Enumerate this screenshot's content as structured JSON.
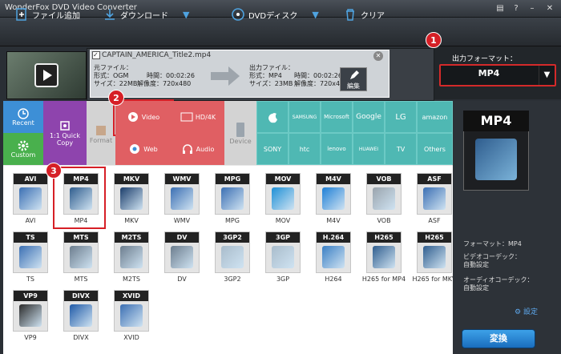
{
  "app": {
    "title": "WonderFox DVD Video Converter"
  },
  "toolbar": {
    "add_file": "ファイル追加",
    "download": "ダウンロード",
    "dvd_disc": "DVDディスク",
    "clear": "クリア"
  },
  "task": {
    "name": "CAPTAIN_AMERICA_Title2.mp4",
    "src_label": "元ファイル：",
    "src_format": "形式：OGM",
    "src_time": "時間：00:02:26",
    "src_size": "サイズ：22MB",
    "src_res": "解像度：720x480",
    "out_label": "出力ファイル：",
    "out_format": "形式：MP4",
    "out_time": "時間：00:02:26",
    "out_size": "サイズ：23MB",
    "out_res": "解像度：720x480",
    "edit": "編集"
  },
  "output": {
    "label": "出力フォーマット：",
    "value": "MP4"
  },
  "badges": {
    "b1": "1",
    "b2": "2",
    "b3": "3"
  },
  "categories": {
    "recent": "Recent",
    "custom": "Custom",
    "quick_copy": "1:1 Quick Copy",
    "format": "Format",
    "video": "Video",
    "hd": "HD/4K",
    "web": "Web",
    "audio": "Audio",
    "device": "Device"
  },
  "brands": {
    "samsung": "SAMSUNG",
    "microsoft": "Microsoft",
    "google": "Google",
    "lg": "LG",
    "amazon": "amazon",
    "sony": "SONY",
    "htc": "htc",
    "lenovo": "lenovo",
    "huawei": "HUAWEI",
    "tv": "TV",
    "others": "Others"
  },
  "formats": [
    {
      "name": "AVI",
      "label": "AVI",
      "color": "#3b6fb3"
    },
    {
      "name": "MP4",
      "label": "MP4",
      "color": "#2f5d8e"
    },
    {
      "name": "MKV",
      "label": "MKV",
      "color": "#1b3d6b"
    },
    {
      "name": "WMV",
      "label": "WMV",
      "color": "#3b6fb3"
    },
    {
      "name": "MPG",
      "label": "MPG",
      "color": "#3b6fb3"
    },
    {
      "name": "MOV",
      "label": "MOV",
      "color": "#1e90d6"
    },
    {
      "name": "M4V",
      "label": "M4V",
      "color": "#1e7fd6"
    },
    {
      "name": "VOB",
      "label": "VOB",
      "color": "#9aa4ad"
    },
    {
      "name": "ASF",
      "label": "ASF",
      "color": "#3b6fb3"
    },
    {
      "name": "TS",
      "label": "TS",
      "color": "#3b6fb3"
    },
    {
      "name": "MTS",
      "label": "MTS",
      "color": "#6c7d8e"
    },
    {
      "name": "M2TS",
      "label": "M2TS",
      "color": "#6c7d8e"
    },
    {
      "name": "DV",
      "label": "DV",
      "color": "#6c7d8e"
    },
    {
      "name": "3GP2",
      "label": "3GP2",
      "color": "#a9bccb"
    },
    {
      "name": "3GP",
      "label": "3GP",
      "color": "#a9bccb"
    },
    {
      "name": "H264",
      "label": "H.264",
      "color": "#3a7fc4"
    },
    {
      "name": "H265 for MP4",
      "label": "H265",
      "color": "#2f5d8e"
    },
    {
      "name": "H265 for MKV",
      "label": "H265",
      "color": "#2f5d8e"
    },
    {
      "name": "VP9",
      "label": "VP9",
      "color": "#2b2b2b"
    },
    {
      "name": "DIVX",
      "label": "DIVX",
      "color": "#1f5aa8"
    },
    {
      "name": "XVID",
      "label": "XVID",
      "color": "#3b6fb3"
    }
  ],
  "info": {
    "format": "フォーマット：MP4",
    "vcodec1": "ビデオコーデック：",
    "vcodec2": "自動設定",
    "acodec1": "オーディオコーデック：",
    "acodec2": "自動設定",
    "settings": "設定",
    "convert": "変換"
  },
  "colors": {
    "accent_red": "#d61f26",
    "teal": "#4fb8b3",
    "purple": "#8e44ad",
    "blue": "#3d8fd6"
  }
}
